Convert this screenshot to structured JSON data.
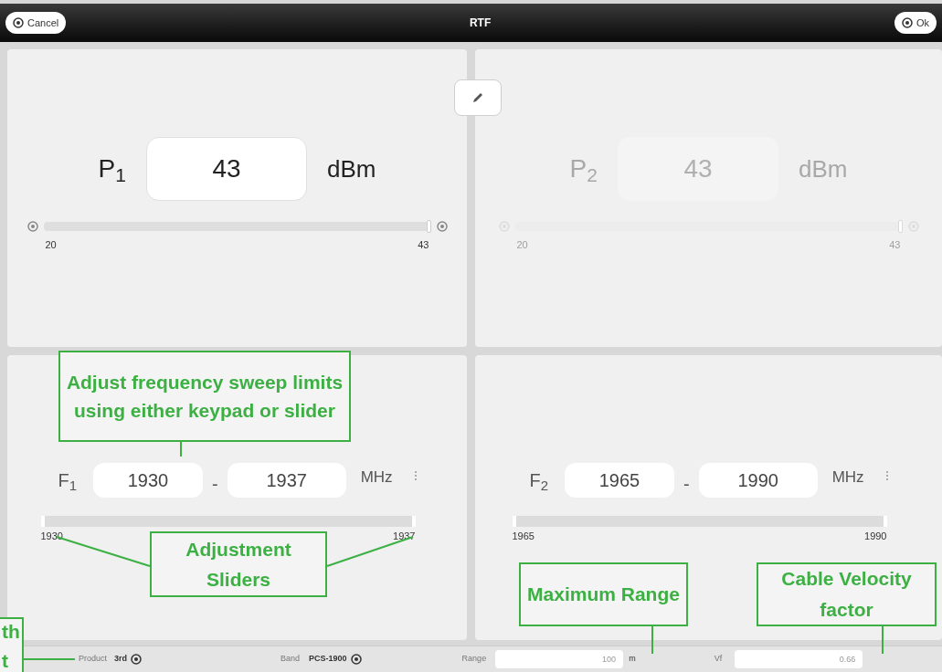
{
  "toolbar": {
    "cancel": "Cancel",
    "title": "RTF",
    "ok": "Ok"
  },
  "power": [
    {
      "label": "P$_{1}$",
      "value": "43",
      "unit": "dBm",
      "disabled": false,
      "min": "20",
      "max": "43",
      "level": 1
    },
    {
      "label": "P$_{2}$",
      "value": "43",
      "unit": "dBm",
      "disabled": true,
      "min": "20",
      "max": "43",
      "level": 1
    }
  ],
  "frequency": [
    {
      "label": "F$_{1}$",
      "start": "1930",
      "separator": "-",
      "end": "1937",
      "unit": "MHz",
      "min": "1930",
      "max": "1937"
    },
    {
      "label": "F$_{2}$",
      "start": "1965",
      "separator": "-",
      "end": "1990",
      "unit": "MHz",
      "min": "1965",
      "max": "1990"
    }
  ],
  "status_bar": {
    "product_label": "Product",
    "product": "3rd",
    "band_label": "Band",
    "band": "PCS-1900",
    "range_label": "Range",
    "range": "100",
    "range_unit": "m",
    "vf_label": "Vf",
    "vf": "0.66"
  },
  "annotations": [
    {
      "text": "Adjust frequency sweep limits using either keypad or slider"
    },
    {
      "text": "Adjustment Sliders"
    },
    {
      "text": "Maximum Range"
    },
    {
      "text": "Cable Velocity factor"
    },
    {
      "text": "th t"
    }
  ]
}
